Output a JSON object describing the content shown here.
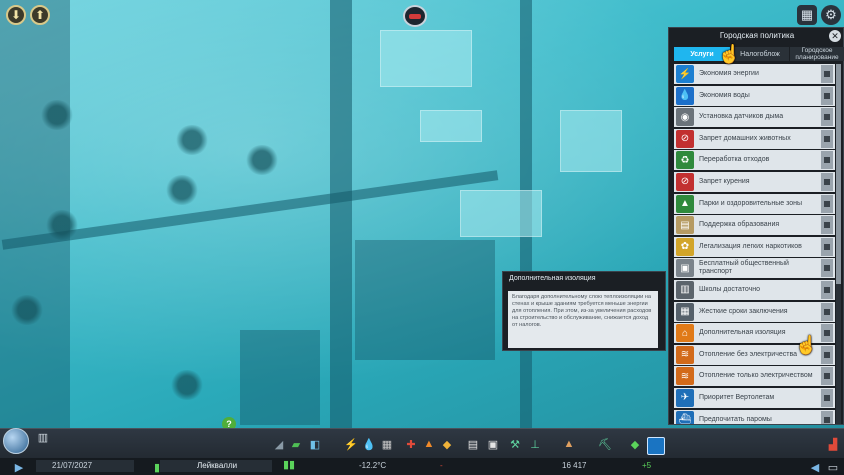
{
  "colors": {
    "accent_tab": "#1fb6ef",
    "panel_bg": "#1b1f24",
    "item_bg": "#dfe5ea",
    "map_tint": "#2fb5c4",
    "positive_green": "#5bd35b",
    "negative_red": "#e04a3a"
  },
  "policy_panel": {
    "title": "Городская политика",
    "close_icon": "close-icon",
    "tabs": [
      {
        "label": "Услуги",
        "active": true
      },
      {
        "label": "Налогоблож",
        "active": false
      },
      {
        "label": "Городское планирование",
        "active": false
      }
    ],
    "items": [
      {
        "label": "Экономия энергии",
        "icon": "lightning-icon",
        "icon_color": "#1c7fd1",
        "glyph": "⚡"
      },
      {
        "label": "Экономия воды",
        "icon": "water-drop-icon",
        "icon_color": "#1c6fc9",
        "glyph": "💧"
      },
      {
        "label": "Установка датчиков дыма",
        "icon": "smoke-detector-icon",
        "icon_color": "#6b737a",
        "glyph": "◉"
      },
      {
        "label": "Запрет домашних животных",
        "icon": "no-pets-icon",
        "icon_color": "#c23030",
        "glyph": "⊘"
      },
      {
        "label": "Переработка отходов",
        "icon": "recycle-icon",
        "icon_color": "#2f8a3c",
        "glyph": "♻"
      },
      {
        "label": "Запрет курения",
        "icon": "no-smoking-icon",
        "icon_color": "#c23030",
        "glyph": "⊘"
      },
      {
        "label": "Парки и оздоровительные зоны",
        "icon": "tree-icon",
        "icon_color": "#2f8a3c",
        "glyph": "▲"
      },
      {
        "label": "Поддержка образования",
        "icon": "book-icon",
        "icon_color": "#b59a62",
        "glyph": "▤"
      },
      {
        "label": "Легализация легких наркотиков",
        "icon": "leaf-icon",
        "icon_color": "#d2a52a",
        "glyph": "✿"
      },
      {
        "label": "Бесплатный общественный транспорт",
        "icon": "bus-icon",
        "icon_color": "#7a838b",
        "glyph": "▣"
      },
      {
        "label": "Школы достаточно",
        "icon": "school-icon",
        "icon_color": "#5b646c",
        "glyph": "▥"
      },
      {
        "label": "Жесткие сроки заключения",
        "icon": "prison-icon",
        "icon_color": "#55606a",
        "glyph": "▦"
      },
      {
        "label": "Дополнительная изоляция",
        "icon": "insulation-icon",
        "icon_color": "#e07a18",
        "glyph": "⌂"
      },
      {
        "label": "Отопление без электричества",
        "icon": "heating-icon",
        "icon_color": "#d26a1a",
        "glyph": "≋"
      },
      {
        "label": "Отопление только электричеством",
        "icon": "electric-heating-icon",
        "icon_color": "#d26a1a",
        "glyph": "≋"
      },
      {
        "label": "Приоритет Вертолетам",
        "icon": "helicopter-icon",
        "icon_color": "#1f6fb8",
        "glyph": "✈"
      },
      {
        "label": "Предпочитать паромы",
        "icon": "ferry-icon",
        "icon_color": "#1f6fb8",
        "glyph": "⛴"
      }
    ]
  },
  "tooltip": {
    "title": "Дополнительная изоляция",
    "text": "Благодаря дополнительному слою теплоизоляции на стенах и крыше зданиям требуется меньше энергии для отопления. При этом, из-за увеличения расходов на строительство и обслуживание, снижается доход от налогов."
  },
  "help": {
    "label": "?"
  },
  "status": {
    "date": "21/07/2027",
    "city_name": "Лейквалли",
    "temperature": "-12.2°C",
    "money": "-",
    "population": "16 417",
    "population_change": "+5"
  }
}
